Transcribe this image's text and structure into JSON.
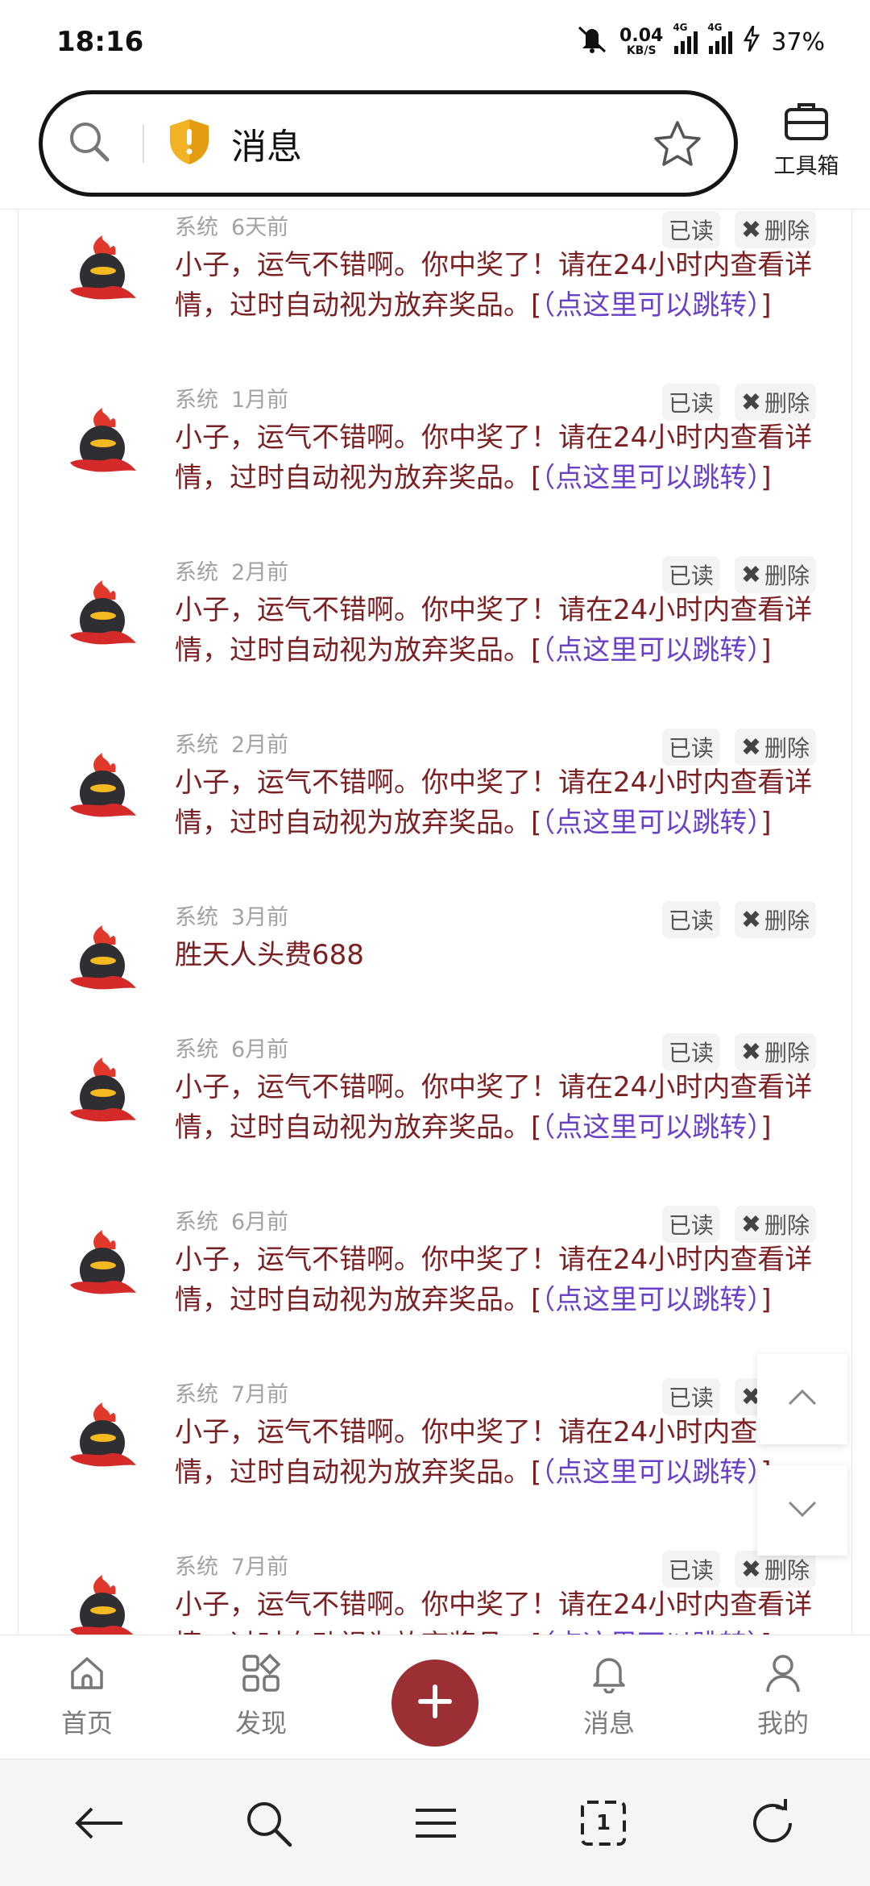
{
  "status_bar": {
    "time": "18:16",
    "speed_value": "0.04",
    "speed_unit": "KB/S",
    "network1": "4G",
    "network2": "4G",
    "battery": "37%"
  },
  "header": {
    "title": "消息",
    "toolbox_label": "工具箱"
  },
  "messages": [
    {
      "source": "系统",
      "time": "6天前",
      "read_label": "已读",
      "delete_label": "删除",
      "text": "小子，运气不错啊。你中奖了！请在24小时内查看详情，过时自动视为放弃奖品。[",
      "link": "（点这里可以跳转）",
      "tail": "]"
    },
    {
      "source": "系统",
      "time": "1月前",
      "read_label": "已读",
      "delete_label": "删除",
      "text": "小子，运气不错啊。你中奖了！请在24小时内查看详情，过时自动视为放弃奖品。[",
      "link": "（点这里可以跳转）",
      "tail": "]"
    },
    {
      "source": "系统",
      "time": "2月前",
      "read_label": "已读",
      "delete_label": "删除",
      "text": "小子，运气不错啊。你中奖了！请在24小时内查看详情，过时自动视为放弃奖品。[",
      "link": "（点这里可以跳转）",
      "tail": "]"
    },
    {
      "source": "系统",
      "time": "2月前",
      "read_label": "已读",
      "delete_label": "删除",
      "text": "小子，运气不错啊。你中奖了！请在24小时内查看详情，过时自动视为放弃奖品。[",
      "link": "（点这里可以跳转）",
      "tail": "]"
    },
    {
      "source": "系统",
      "time": "3月前",
      "read_label": "已读",
      "delete_label": "删除",
      "text": "胜天人头费688",
      "link": "",
      "tail": ""
    },
    {
      "source": "系统",
      "time": "6月前",
      "read_label": "已读",
      "delete_label": "删除",
      "text": "小子，运气不错啊。你中奖了！请在24小时内查看详情，过时自动视为放弃奖品。[",
      "link": "（点这里可以跳转）",
      "tail": "]"
    },
    {
      "source": "系统",
      "time": "6月前",
      "read_label": "已读",
      "delete_label": "删除",
      "text": "小子，运气不错啊。你中奖了！请在24小时内查看详情，过时自动视为放弃奖品。[",
      "link": "（点这里可以跳转）",
      "tail": "]"
    },
    {
      "source": "系统",
      "time": "7月前",
      "read_label": "已读",
      "delete_label": "删除",
      "text": "小子，运气不错啊。你中奖了！请在24小时内查看详情，过时自动视为放弃奖品。[",
      "link": "（点这里可以跳转）",
      "tail": "]"
    },
    {
      "source": "系统",
      "time": "7月前",
      "read_label": "已读",
      "delete_label": "删除",
      "text": "小子，运气不错啊。你中奖了！请在24小时内查看详情，过时自动视为放弃奖品。[",
      "link": "（点这里可以跳转）",
      "tail": "]"
    }
  ],
  "tabbar": {
    "home": "首页",
    "discover": "发现",
    "messages": "消息",
    "mine": "我的"
  },
  "browser_nav": {
    "tab_count": "1"
  },
  "colors": {
    "accent": "#9c2f33",
    "message_text": "#7a1f22",
    "link": "#6a40c8",
    "meta": "#a2a2a2"
  }
}
